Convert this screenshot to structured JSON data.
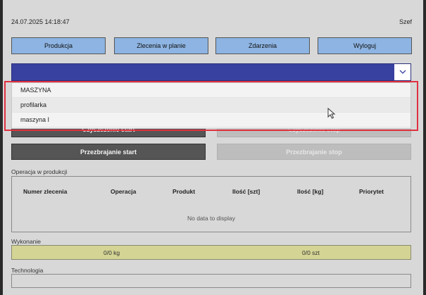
{
  "header": {
    "datetime": "24.07.2025 14:18:47",
    "user": "Szef"
  },
  "nav": {
    "produkcja": "Produkcja",
    "zlecenia": "Zlecenia w planie",
    "zdarzenia": "Zdarzenia",
    "wyloguj": "Wyloguj"
  },
  "dropdown": {
    "options": [
      "MASZYNA",
      "profilarka",
      "maszyna I"
    ]
  },
  "actions": {
    "czyszczenie_start": "Czyszczenie start",
    "czyszczenie_stop": "Czyszczenie stop",
    "przezbrajanie_start": "Przezbrajanie start",
    "przezbrajanie_stop": "Przezbrajanie stop"
  },
  "operacja": {
    "label": "Operacja w produkcji",
    "columns": [
      "Numer zlecenia",
      "Operacja",
      "Produkt",
      "Ilość [szt]",
      "Ilość [kg]",
      "Priorytet"
    ],
    "empty": "No data to display"
  },
  "wykonanie": {
    "label": "Wykonanie",
    "kg": "0/0 kg",
    "szt": "0/0 szt"
  },
  "technologia": {
    "label": "Technologia"
  },
  "colors": {
    "nav_button": "#8db4e2",
    "dropdown": "#3941a0",
    "highlight": "#e03040",
    "progress": "#d4d494",
    "active_button": "#555555"
  }
}
